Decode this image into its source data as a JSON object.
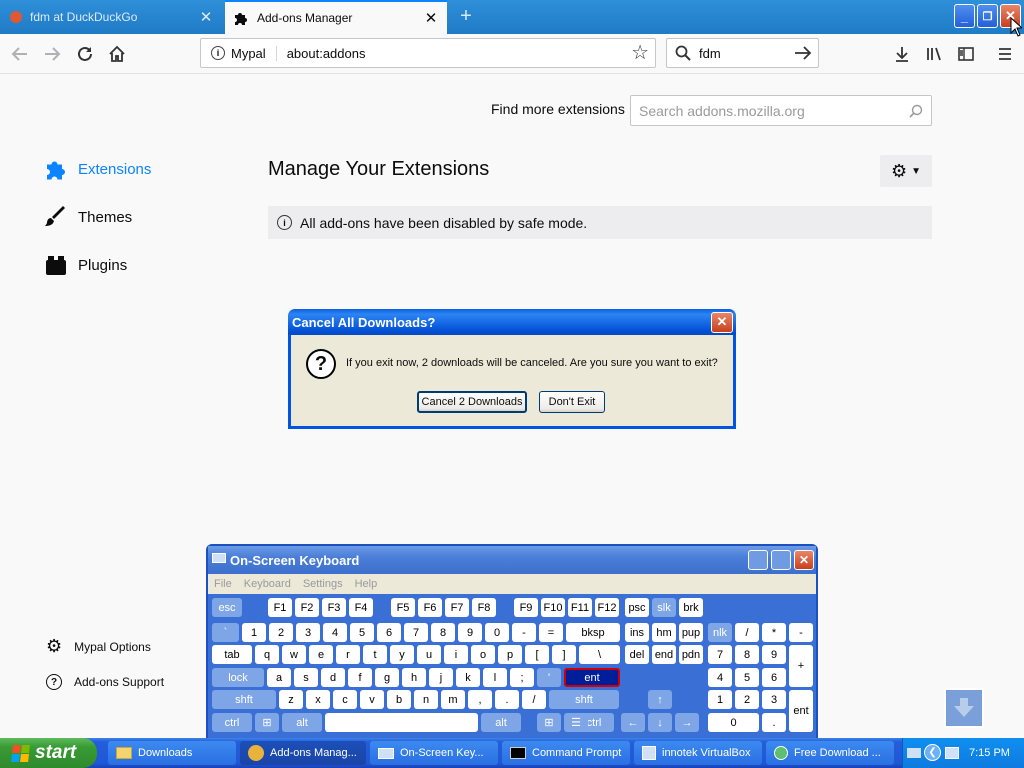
{
  "browser": {
    "tabs": [
      {
        "title": "fdm at DuckDuckGo",
        "active": false
      },
      {
        "title": "Add-ons Manager",
        "active": true
      }
    ],
    "identity_label": "Mypal",
    "url": "about:addons",
    "search_value": "fdm"
  },
  "addons": {
    "find_more_label": "Find more extensions",
    "search_placeholder": "Search addons.mozilla.org",
    "categories": [
      {
        "label": "Extensions",
        "icon": "puzzle-icon",
        "selected": true
      },
      {
        "label": "Themes",
        "icon": "brush-icon",
        "selected": false
      },
      {
        "label": "Plugins",
        "icon": "plugin-block-icon",
        "selected": false
      }
    ],
    "heading": "Manage Your Extensions",
    "notice": "All add-ons have been disabled by safe mode.",
    "bottom_links": [
      {
        "label": "Mypal Options",
        "icon": "gear-icon"
      },
      {
        "label": "Add-ons Support",
        "icon": "help-icon"
      }
    ]
  },
  "dialog": {
    "title": "Cancel All Downloads?",
    "message": "If you exit now, 2 downloads will be canceled. Are you sure you want to exit?",
    "primary_button": "Cancel 2 Downloads",
    "secondary_button": "Don't Exit"
  },
  "osk": {
    "title": "On-Screen Keyboard",
    "menu": [
      "File",
      "Keyboard",
      "Settings",
      "Help"
    ],
    "rows": {
      "r1": [
        "esc",
        "F1",
        "F2",
        "F3",
        "F4",
        "F5",
        "F6",
        "F7",
        "F8",
        "F9",
        "F10",
        "F11",
        "F12",
        "psc",
        "slk",
        "brk"
      ],
      "r2": [
        "`",
        "1",
        "2",
        "3",
        "4",
        "5",
        "6",
        "7",
        "8",
        "9",
        "0",
        "-",
        "=",
        "bksp",
        "ins",
        "hm",
        "pup",
        "nlk",
        "/",
        "*",
        "-"
      ],
      "r3": [
        "tab",
        "q",
        "w",
        "e",
        "r",
        "t",
        "y",
        "u",
        "i",
        "o",
        "p",
        "[",
        "]",
        "\\",
        "del",
        "end",
        "pdn",
        "7",
        "8",
        "9",
        "+"
      ],
      "r4": [
        "lock",
        "a",
        "s",
        "d",
        "f",
        "g",
        "h",
        "j",
        "k",
        "l",
        ";",
        "'",
        "ent",
        "4",
        "5",
        "6"
      ],
      "r5": [
        "shft",
        "z",
        "x",
        "c",
        "v",
        "b",
        "n",
        "m",
        ",",
        ".",
        "/",
        "shft",
        "1",
        "2",
        "3",
        "ent"
      ],
      "r6": [
        "ctrl",
        "alt",
        "alt",
        "ctrl",
        "0",
        "."
      ]
    }
  },
  "taskbar": {
    "start_label": "start",
    "tasks": [
      {
        "label": "Downloads",
        "active": false
      },
      {
        "label": "Add-ons Manag...",
        "active": true
      },
      {
        "label": "On-Screen Key...",
        "active": false
      },
      {
        "label": "Command Prompt",
        "active": false
      },
      {
        "label": "innotek VirtualBox",
        "active": false
      },
      {
        "label": "Free Download ...",
        "active": false
      }
    ],
    "clock": "7:15 PM"
  }
}
